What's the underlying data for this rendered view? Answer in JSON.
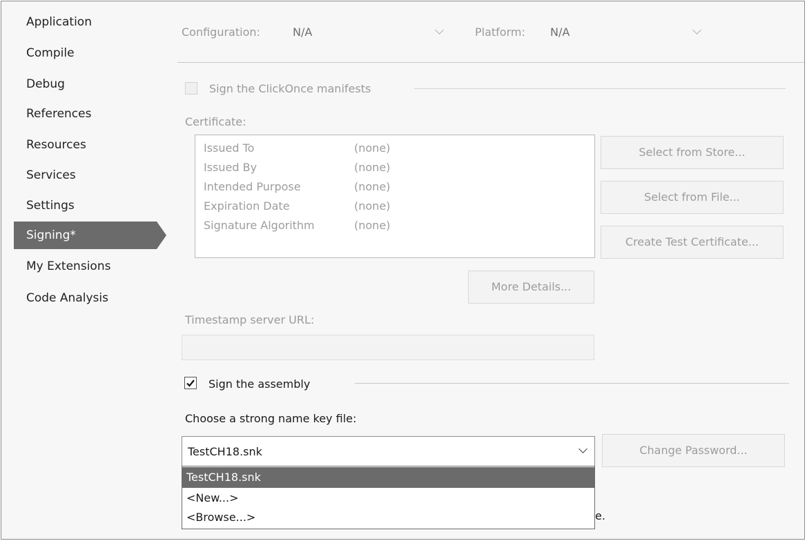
{
  "sidebar": {
    "items": [
      {
        "label": "Application"
      },
      {
        "label": "Compile"
      },
      {
        "label": "Debug"
      },
      {
        "label": "References"
      },
      {
        "label": "Resources"
      },
      {
        "label": "Services"
      },
      {
        "label": "Settings"
      },
      {
        "label": "Signing*",
        "active": true
      },
      {
        "label": "My Extensions"
      },
      {
        "label": "Code Analysis"
      }
    ]
  },
  "config": {
    "configuration_label": "Configuration:",
    "configuration_value": "N/A",
    "platform_label": "Platform:",
    "platform_value": "N/A"
  },
  "clickonce": {
    "sign_label": "Sign the ClickOnce manifests",
    "sign_checked": false,
    "certificate_label": "Certificate:",
    "certificate_rows": [
      {
        "key": "Issued To",
        "value": "(none)"
      },
      {
        "key": "Issued By",
        "value": "(none)"
      },
      {
        "key": "Intended Purpose",
        "value": "(none)"
      },
      {
        "key": "Expiration Date",
        "value": "(none)"
      },
      {
        "key": "Signature Algorithm",
        "value": "(none)"
      }
    ],
    "select_store_label": "Select from Store...",
    "select_file_label": "Select from File...",
    "create_test_label": "Create Test Certificate...",
    "more_details_label": "More Details...",
    "timestamp_label": "Timestamp server URL:",
    "timestamp_value": ""
  },
  "assembly": {
    "sign_label": "Sign the assembly",
    "sign_checked": true,
    "key_file_label": "Choose a strong name key file:",
    "key_file_value": "TestCH18.snk",
    "change_password_label": "Change Password...",
    "dropdown_options": [
      "TestCH18.snk",
      "<New...>",
      "<Browse...>"
    ],
    "selected_option": "TestCH18.snk",
    "trailing_text": "e."
  },
  "colors": {
    "active_nav": "#6b6b6b",
    "disabled_text": "#9d9d9d",
    "background": "#f7f7f7"
  }
}
